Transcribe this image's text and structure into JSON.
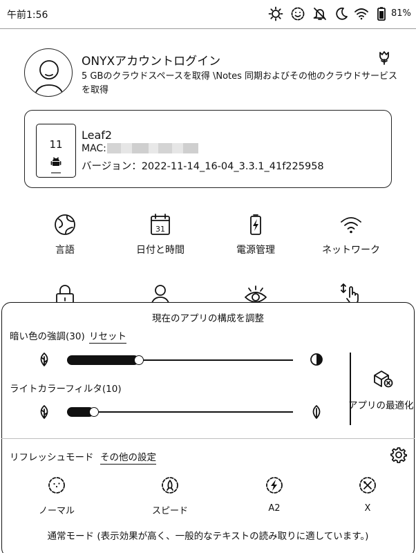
{
  "status_bar": {
    "time": "午前1:56",
    "battery_percent": "81%",
    "icons": [
      "brightness-icon",
      "mood-icon",
      "bell-off-icon",
      "moon-icon",
      "wifi-icon",
      "battery-icon"
    ]
  },
  "account": {
    "title": "ONYXアカウントログイン",
    "subtitle": "5 GBのクラウドスペースを取得 \\Notes 同期およびその他のクラウドサービスを取得",
    "icon": "tulip-icon"
  },
  "device": {
    "screen_number": "11",
    "name": "Leaf2",
    "mac_label": "MAC:",
    "version": "バージョン：2022-11-14_16-04_3.3.1_41f225958"
  },
  "settings_grid": [
    {
      "label": "言語",
      "icon": "globe-icon"
    },
    {
      "label": "日付と時間",
      "icon": "calendar-icon"
    },
    {
      "label": "電源管理",
      "icon": "battery-charge-icon"
    },
    {
      "label": "ネットワーク",
      "icon": "wifi-icon"
    },
    {
      "label": "",
      "icon": "lock-icon"
    },
    {
      "label": "",
      "icon": "user-icon"
    },
    {
      "label": "",
      "icon": "eye-icon"
    },
    {
      "label": "",
      "icon": "touch-icon"
    }
  ],
  "panel": {
    "title": "現在のアプリの構成を調整",
    "dark_enhance": {
      "label": "暗い色の強調(30)",
      "reset_label": "リセット",
      "level": 30
    },
    "light_filter": {
      "label": "ライトカラーフィルタ(10)",
      "level": 10
    },
    "optimize_label": "アプリの最適化",
    "refresh_mode_label": "リフレッシュモード",
    "other_settings_label": "その他の設定",
    "modes": [
      {
        "label": "ノーマル",
        "icon": "normal-mode-icon"
      },
      {
        "label": "スピード",
        "icon": "speed-mode-icon"
      },
      {
        "label": "A2",
        "icon": "a2-mode-icon"
      },
      {
        "label": "X",
        "icon": "x-mode-icon"
      }
    ],
    "mode_description": "通常モード (表示効果が高く、一般的なテキストの読み取りに適しています。)"
  }
}
